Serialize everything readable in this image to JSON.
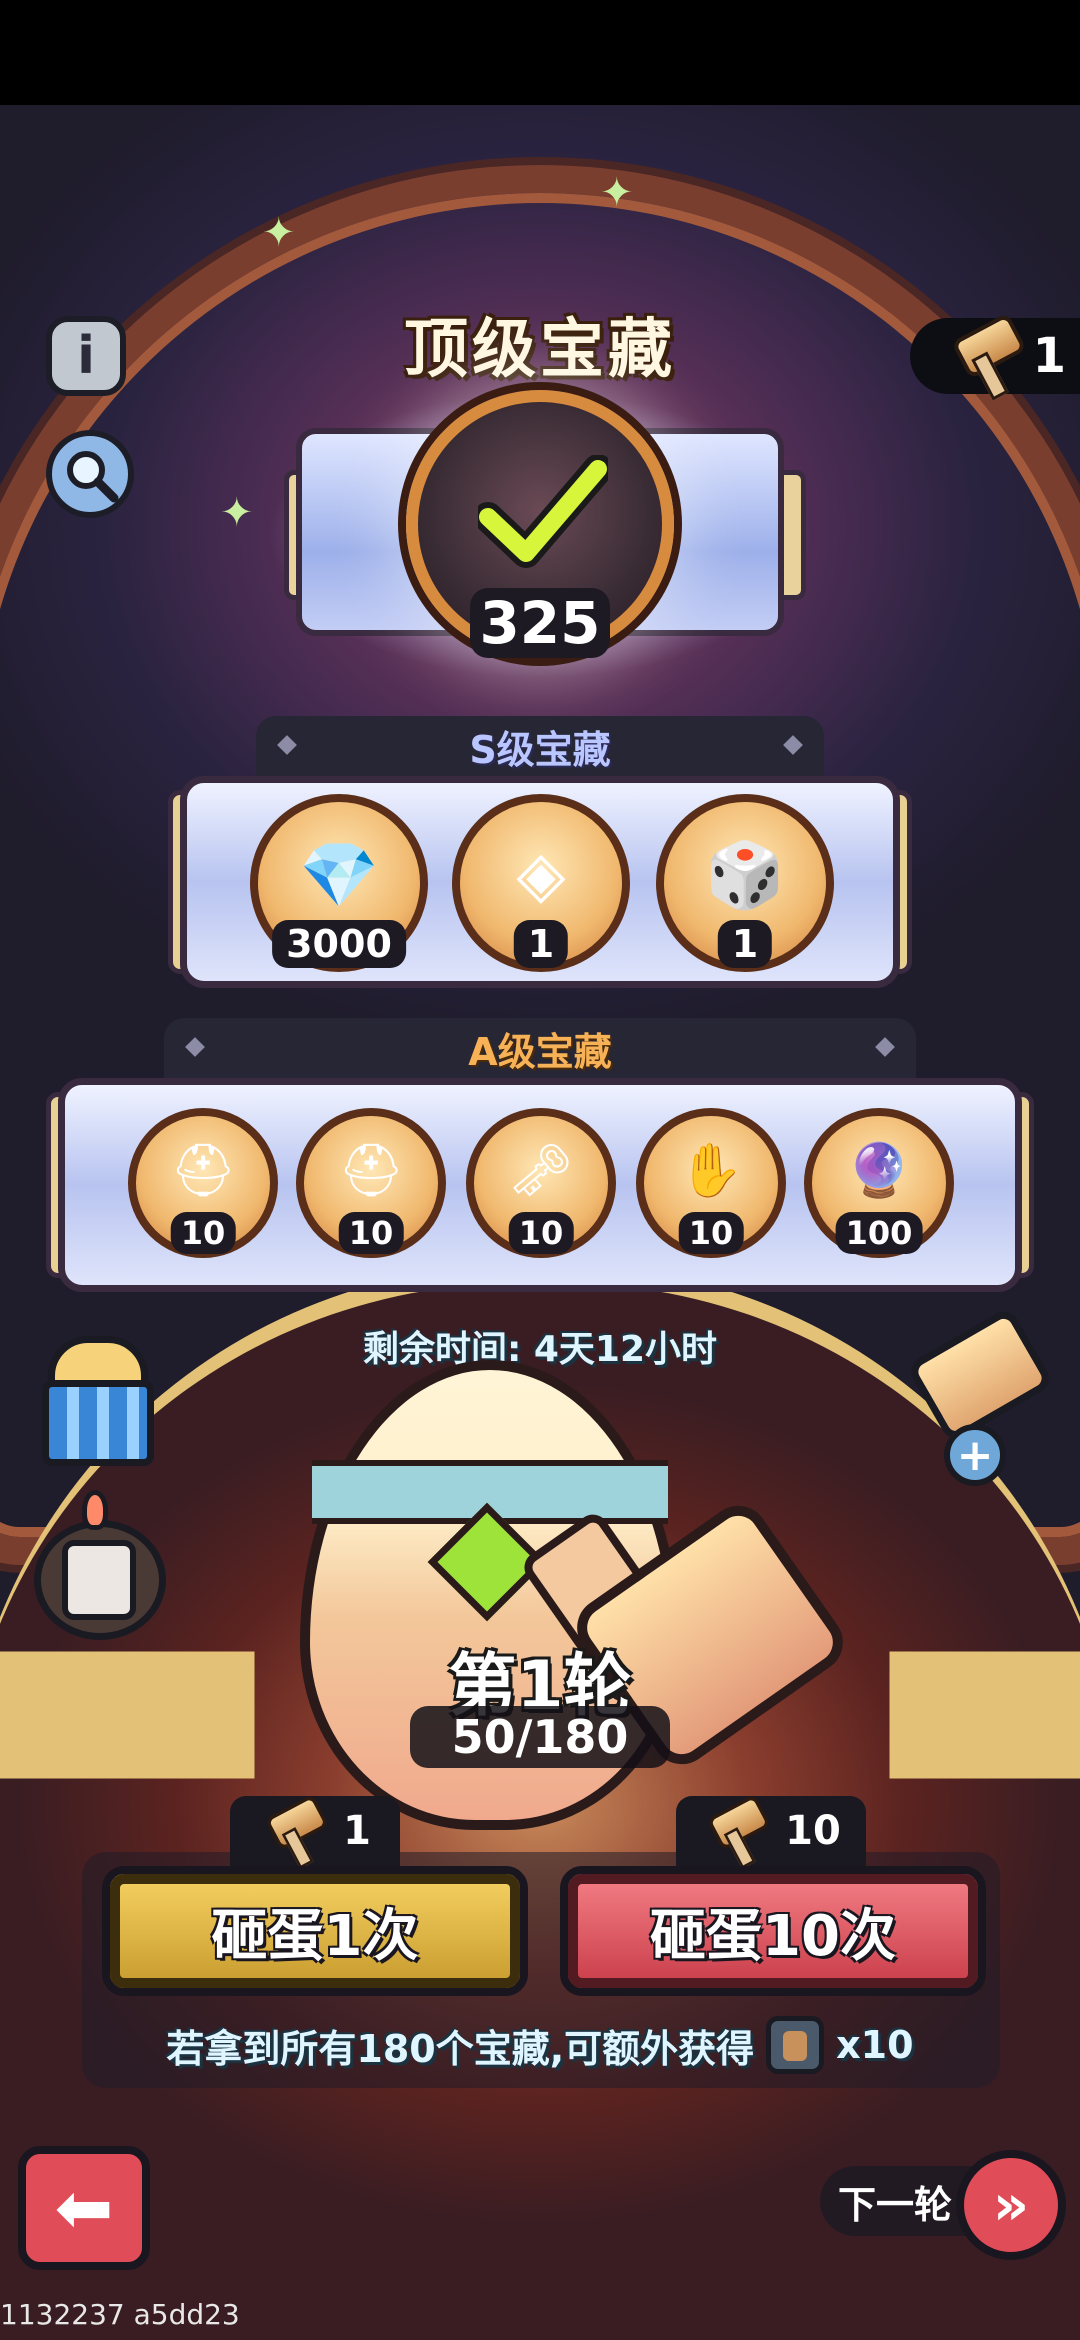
{
  "title": "顶级宝藏",
  "hammer_count": "1",
  "grand_prize": {
    "count": "325",
    "claimed": true
  },
  "s_tier": {
    "label": "S级宝藏",
    "items": [
      {
        "icon": "gem-icon",
        "qty": "3000"
      },
      {
        "icon": "emblem-icon",
        "qty": "1"
      },
      {
        "icon": "ssr-ticket-icon",
        "qty": "1"
      }
    ]
  },
  "a_tier": {
    "label": "A级宝藏",
    "items": [
      {
        "icon": "iron-helmet-icon",
        "qty": "10"
      },
      {
        "icon": "bronze-helmet-icon",
        "qty": "10"
      },
      {
        "icon": "key-icon",
        "qty": "10"
      },
      {
        "icon": "scroll-icon",
        "qty": "10"
      },
      {
        "icon": "purple-orb-icon",
        "qty": "100"
      }
    ]
  },
  "remaining_time": "剩余时间: 4天12小时",
  "round": {
    "label": "第1轮",
    "progress": "50/180"
  },
  "smash_one": {
    "cost": "1",
    "label": "砸蛋1次"
  },
  "smash_ten": {
    "cost": "10",
    "label": "砸蛋10次"
  },
  "bonus": {
    "text": "若拿到所有180个宝藏,可额外获得",
    "reward_qty": "x10"
  },
  "next_round_label": "下一轮",
  "build_id": "1132237 a5dd23",
  "colors": {
    "gold_button": "#f6d263",
    "red_button": "#e04c57",
    "tier_s_text": "#b9c6ff",
    "tier_a_text": "#f7b257"
  }
}
